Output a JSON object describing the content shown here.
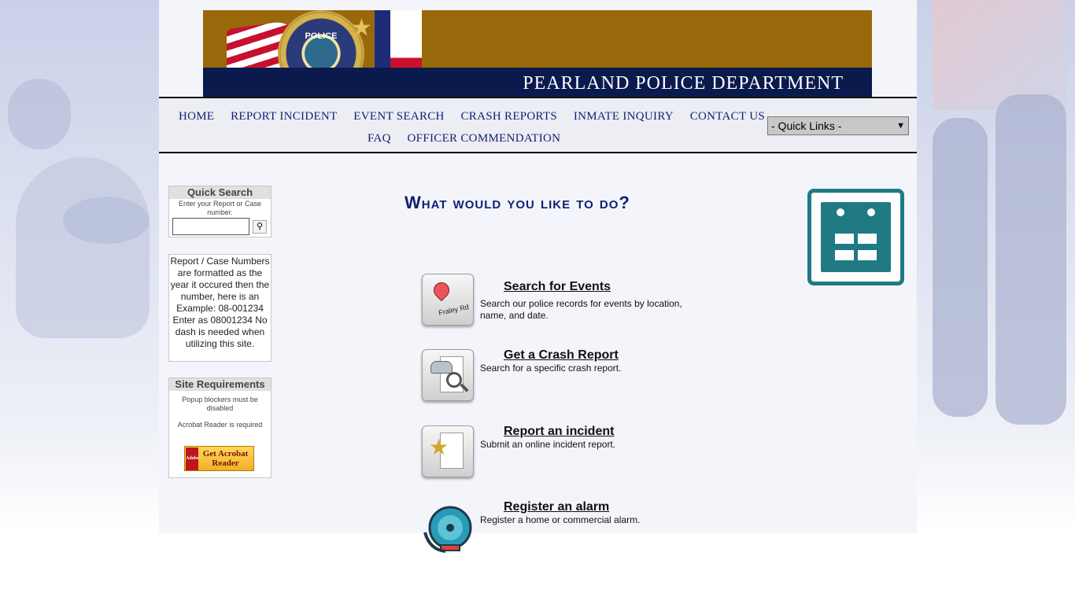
{
  "banner": {
    "title": "PEARLAND POLICE DEPARTMENT",
    "badge_text": "POLICE"
  },
  "nav": {
    "items_row1": [
      "HOME",
      "REPORT INCIDENT",
      "EVENT SEARCH",
      "CRASH REPORTS",
      "INMATE INQUIRY",
      "CONTACT US"
    ],
    "items_row2": [
      "FAQ",
      "OFFICER COMMENDATION"
    ],
    "quick_links": "- Quick Links -"
  },
  "sidebar": {
    "quick_search": {
      "title": "Quick Search",
      "help": "Enter your Report or Case number.",
      "button_icon": "search-icon"
    },
    "note": "Report / Case Numbers are formatted as the year it occured then the number, here is an Example: 08-001234 Enter as 08001234 No dash is needed when utilizing this site.",
    "site_requirements": {
      "title": "Site Requirements",
      "line1": "Popup blockers must be disabled",
      "line2": "Acrobat Reader is required",
      "acrobat_label": "Get Acrobat Reader",
      "acrobat_brand": "Adobe"
    }
  },
  "main": {
    "title": "What would you like to do?",
    "actions": [
      {
        "title": "Search for Events",
        "desc": "Search our police records for events by location, name, and date.",
        "icon": "map-pin-icon",
        "road": "Fraley Rd"
      },
      {
        "title": "Get a Crash Report",
        "desc": "Search for a specific crash report.",
        "icon": "crash-report-icon"
      },
      {
        "title": "Report an incident",
        "desc": "Submit an online incident report.",
        "icon": "incident-report-icon"
      },
      {
        "title": "Register an alarm",
        "desc": "Register a home or commercial alarm.",
        "icon": "alarm-bell-icon"
      }
    ],
    "calendar_icon": "calendar-icon"
  },
  "colors": {
    "nav_text": "#0f1f73",
    "banner_gold": "#98690a",
    "banner_navy": "#0b1a4d",
    "calendar_teal": "#1f7a84"
  }
}
